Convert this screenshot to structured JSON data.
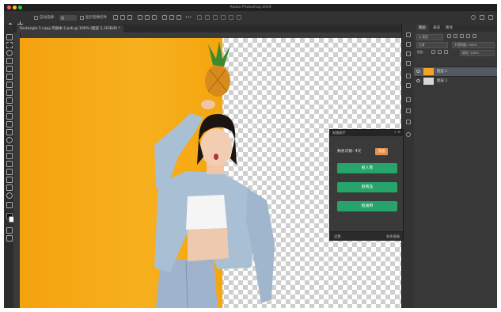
{
  "app": {
    "title": "Adobe Photoshop 2019",
    "colors": {
      "close": "#ff5f57",
      "minimize": "#febc2e",
      "maximize": "#28c840"
    }
  },
  "options_bar": {
    "items": [
      "自动选择:",
      "组",
      "显示变换控件"
    ],
    "right_icons": [
      "search-icon",
      "workspace-icon",
      "share-icon"
    ]
  },
  "document": {
    "tab_label": "Rectangle 1 copy 的副本 2.psb @ 100% (图层 1, RGB/8) *"
  },
  "layers_panel": {
    "tabs": [
      "图层",
      "通道",
      "路径"
    ],
    "kind_filter": "Q 类型",
    "blend_mode": "正常",
    "opacity_label": "不透明度: 100%",
    "lock_label": "锁定:",
    "fill_label": "填充: 100%",
    "layers": [
      {
        "name": "图层 1",
        "selected": true,
        "thumb": "#f3a32a"
      },
      {
        "name": "图层 2",
        "selected": false,
        "thumb": "#d8d8d8"
      }
    ]
  },
  "plugin_panel": {
    "title": "抠图助手",
    "count_label": "剩余次数: 4次",
    "recharge_label": "充值",
    "buttons": [
      "抠人像",
      "抠商品",
      "抠通用"
    ],
    "footer_left": "设置",
    "footer_right": "联系客服"
  }
}
